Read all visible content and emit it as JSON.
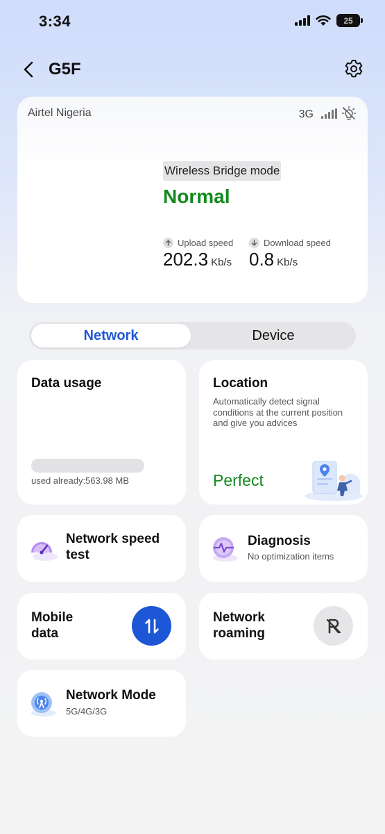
{
  "status_bar": {
    "time": "3:34",
    "battery": "25"
  },
  "header": {
    "title": "G5F"
  },
  "status": {
    "carrier": "Airtel Nigeria",
    "network_type": "3G",
    "mode_label": "Wireless Bridge mode",
    "mode_value": "Normal",
    "upload": {
      "label": "Upload speed",
      "value": "202.3",
      "unit": "Kb/s"
    },
    "download": {
      "label": "Download speed",
      "value": "0.8",
      "unit": "Kb/s"
    }
  },
  "tabs": [
    {
      "label": "Network",
      "active": true
    },
    {
      "label": "Device",
      "active": false
    }
  ],
  "data_usage": {
    "title": "Data usage",
    "used_text": "used already:563.98 MB"
  },
  "location": {
    "title": "Location",
    "description": "Automatically detect signal conditions at the current position and give you advices",
    "status": "Perfect"
  },
  "speed_test": {
    "title": "Network speed test"
  },
  "diagnosis": {
    "title": "Diagnosis",
    "subtitle": "No optimization items"
  },
  "mobile_data": {
    "title": "Mobile data",
    "enabled": true
  },
  "roaming": {
    "title": "Network roaming",
    "enabled": false
  },
  "network_mode": {
    "title": "Network Mode",
    "subtitle": "5G/4G/3G"
  },
  "colors": {
    "accent": "#1e57d6",
    "good": "#128a1e"
  },
  "icons": [
    "back-arrow-icon",
    "gear-icon",
    "signal-icon",
    "wifi-icon",
    "battery-icon",
    "bulb-icon",
    "arrow-up-icon",
    "arrow-down-icon",
    "speedometer-icon",
    "diagnosis-icon",
    "data-transfer-icon",
    "roaming-icon",
    "network-mode-icon",
    "location-illustration"
  ]
}
